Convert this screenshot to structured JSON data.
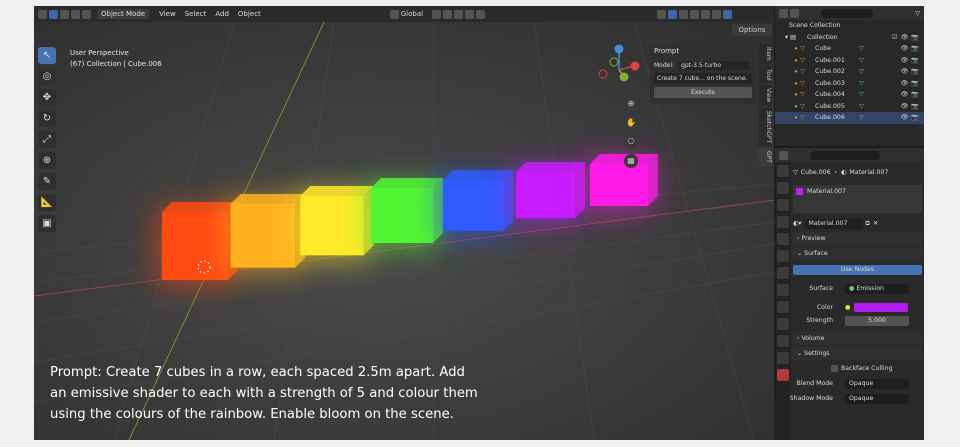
{
  "header": {
    "editor_mode": "Object Mode",
    "menus": [
      "View",
      "Select",
      "Add",
      "Object"
    ],
    "transform_orientation": "Global",
    "options_label": "Options"
  },
  "viewport": {
    "perspective_label": "User Perspective",
    "collection_label": "(67) Collection | Cube.006",
    "cube_colors": [
      "#ff4a12",
      "#ffb11f",
      "#ffea29",
      "#52f531",
      "#2f5bff",
      "#c81bff",
      "#ff1ce8"
    ],
    "caption_lines": [
      "Prompt: Create 7 cubes in a row, each spaced 2.5m apart. Add",
      "an emissive shader to each with a strength of 5 and colour them",
      "using the colours of the rainbow. Enable bloom on the scene."
    ]
  },
  "prompt_panel": {
    "title": "Prompt",
    "model_label": "Model:",
    "model_value": "gpt-3.5-turbo",
    "prompt_text": "Create 7 cube... on the scene.",
    "execute_label": "Execute"
  },
  "side_tabs": [
    "Item",
    "Tool",
    "View",
    "SketchGPT",
    "GPT"
  ],
  "outliner": {
    "scene_collection": "Scene Collection",
    "collection": "Collection",
    "objects": [
      "Cube",
      "Cube.001",
      "Cube.002",
      "Cube.003",
      "Cube.004",
      "Cube.005",
      "Cube.006"
    ]
  },
  "properties": {
    "breadcrumb_object": "Cube.006",
    "breadcrumb_material": "Material.007",
    "material_slot": "Material.007",
    "material_name": "Material.007",
    "preview_label": "Preview",
    "surface_section": "Surface",
    "use_nodes_label": "Use Nodes",
    "surface_label": "Surface",
    "surface_value": "Emission",
    "color_label": "Color",
    "color_value": "#b31bf0",
    "strength_label": "Strength",
    "strength_value": "5.000",
    "volume_section": "Volume",
    "settings_section": "Settings",
    "backface_culling_label": "Backface Culling",
    "blend_mode_label": "Blend Mode",
    "blend_mode_value": "Opaque",
    "shadow_mode_label": "Shadow Mode",
    "shadow_mode_value": "Opaque"
  }
}
